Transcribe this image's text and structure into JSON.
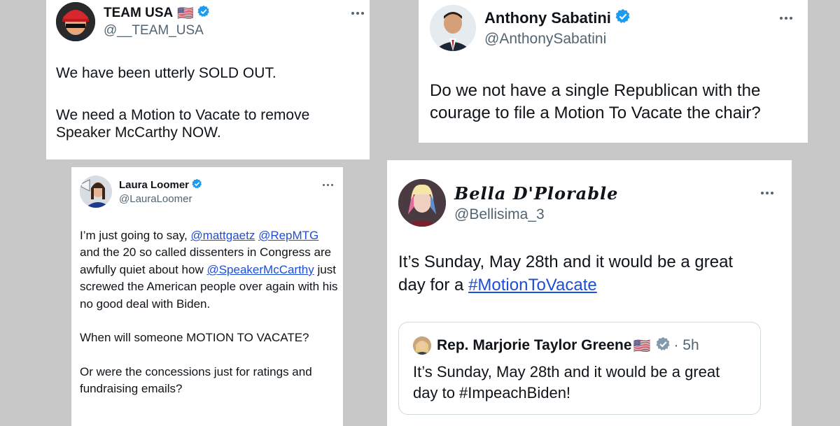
{
  "tweets": [
    {
      "name": "TEAM USA",
      "flag": "🇺🇸",
      "handle": "@__TEAM_USA",
      "lines": [
        "We have been utterly SOLD OUT.",
        "",
        "We need a Motion to Vacate to remove",
        "Speaker McCarthy NOW."
      ]
    },
    {
      "name": "Anthony Sabatini",
      "handle": "@AnthonySabatini",
      "lines": [
        "Do we not have a single Republican with the",
        "courage to file a Motion To Vacate the chair?"
      ]
    },
    {
      "name": "Laura Loomer",
      "handle": "@LauraLoomer",
      "p1": {
        "lead": "I’m just going to say, ",
        "mention1": "@mattgaetz",
        "mention2": "@RepMTG",
        "mid": "and the 20 so called dissenters in Congress are awfully quiet about how ",
        "mention3": "@SpeakerMcCarthy",
        "tail": " just screwed the American people over again with his no good deal with Biden."
      },
      "p2": "When will someone MOTION TO VACATE?",
      "p3": "Or were the concessions just for ratings and fundraising emails?"
    },
    {
      "name": "𝑩𝒆𝒍𝒍𝒂 𝑫'𝑷𝒍𝒐𝒓𝒂𝒃𝒍𝒆",
      "handle": "@Bellisima_3",
      "line1": "It’s Sunday, May 28th and it would be a great",
      "line2_lead": "day for a ",
      "hashtag": "#MotionToVacate",
      "quote": {
        "name": "Rep. Marjorie Taylor Greene",
        "flag": "🇺🇸",
        "time": "· 5h",
        "line1": "It’s Sunday, May 28th and it would be a great",
        "line2": "day to #ImpeachBiden!"
      }
    }
  ],
  "colors": {
    "verified_blue": "#1d9bf0",
    "verified_gray": "#829aab",
    "link_blue": "#1d4ed8",
    "background": "#c8c8c8"
  },
  "icons": {
    "verified": "verified-badge-icon",
    "more": "more-options-icon"
  }
}
